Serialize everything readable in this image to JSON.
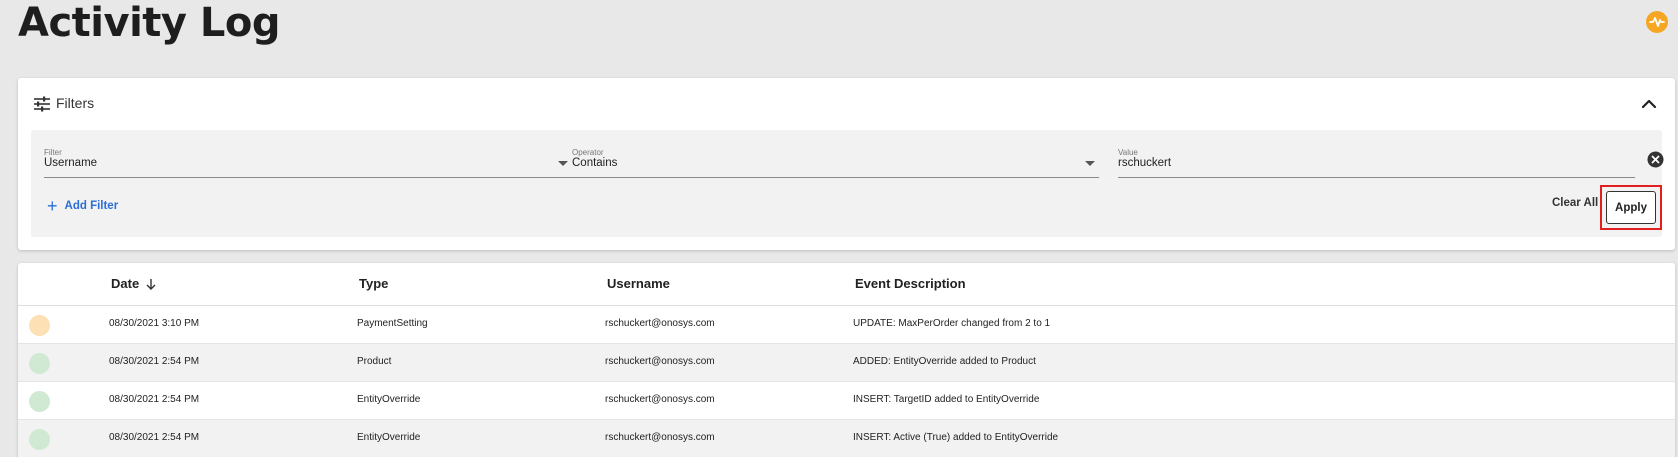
{
  "page": {
    "title": "Activity Log",
    "accent_color": "#f5a623"
  },
  "filters": {
    "label": "Filters",
    "rows": [
      {
        "filter_label": "Filter",
        "filter_value": "Username",
        "operator_label": "Operator",
        "operator_value": "Contains",
        "value_label": "Value",
        "value_value": "rschuckert"
      }
    ],
    "add_filter_label": "Add Filter",
    "clear_all_label": "Clear All",
    "apply_label": "Apply"
  },
  "table": {
    "columns": [
      "Date",
      "Type",
      "Username",
      "Event Description"
    ],
    "sort_icon": "arrow-down-icon",
    "rows": [
      {
        "status_color": "#fde0b3",
        "date": "08/30/2021 3:10 PM",
        "type": "PaymentSetting",
        "username": "rschuckert@onosys.com",
        "description": "UPDATE: MaxPerOrder changed from 2 to 1"
      },
      {
        "status_color": "#cfe9d3",
        "date": "08/30/2021 2:54 PM",
        "type": "Product",
        "username": "rschuckert@onosys.com",
        "description": "ADDED: EntityOverride added to Product"
      },
      {
        "status_color": "#cfe9d3",
        "date": "08/30/2021 2:54 PM",
        "type": "EntityOverride",
        "username": "rschuckert@onosys.com",
        "description": "INSERT: TargetID added to EntityOverride"
      },
      {
        "status_color": "#cfe9d3",
        "date": "08/30/2021 2:54 PM",
        "type": "EntityOverride",
        "username": "rschuckert@onosys.com",
        "description": "INSERT: Active (True) added to EntityOverride"
      }
    ]
  }
}
